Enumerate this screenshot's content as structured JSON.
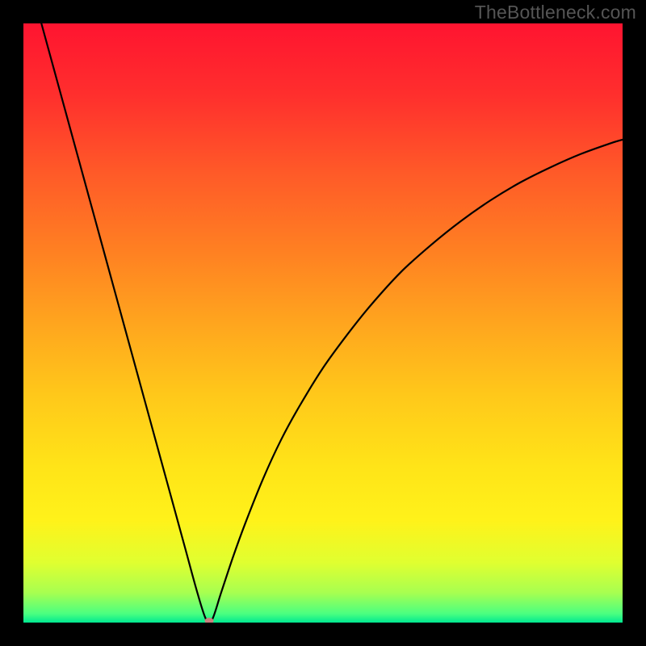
{
  "watermark": "TheBottleneck.com",
  "chart_data": {
    "type": "line",
    "title": "",
    "xlabel": "",
    "ylabel": "",
    "xlim": [
      0,
      100
    ],
    "ylim": [
      0,
      100
    ],
    "background_gradient_stops": [
      {
        "offset": 0.0,
        "color": "#ff1430"
      },
      {
        "offset": 0.12,
        "color": "#ff2f2d"
      },
      {
        "offset": 0.25,
        "color": "#ff5a28"
      },
      {
        "offset": 0.38,
        "color": "#ff8022"
      },
      {
        "offset": 0.5,
        "color": "#ffa51e"
      },
      {
        "offset": 0.62,
        "color": "#ffc81a"
      },
      {
        "offset": 0.74,
        "color": "#ffe418"
      },
      {
        "offset": 0.83,
        "color": "#fff21a"
      },
      {
        "offset": 0.9,
        "color": "#e0ff30"
      },
      {
        "offset": 0.95,
        "color": "#a8ff50"
      },
      {
        "offset": 0.985,
        "color": "#4bff80"
      },
      {
        "offset": 1.0,
        "color": "#00e890"
      }
    ],
    "series": [
      {
        "name": "bottleneck-curve",
        "color": "#000000",
        "x": [
          3,
          5,
          7,
          9,
          11,
          13,
          15,
          17,
          19,
          21,
          23,
          25,
          27,
          29,
          30.5,
          31.5,
          33,
          35,
          37,
          40,
          43,
          46,
          50,
          54,
          58,
          63,
          68,
          73,
          78,
          83,
          88,
          93,
          98,
          100
        ],
        "y": [
          100,
          92.7,
          85.4,
          78.1,
          70.8,
          63.5,
          56.2,
          48.9,
          41.6,
          34.3,
          27.0,
          19.7,
          12.4,
          5.1,
          0.5,
          0.5,
          5.0,
          11.0,
          16.5,
          24.0,
          30.5,
          36.0,
          42.5,
          48.0,
          53.0,
          58.5,
          63.0,
          67.0,
          70.5,
          73.5,
          76.0,
          78.2,
          80.0,
          80.6
        ]
      }
    ],
    "marker": {
      "x": 31.0,
      "y": 0.3,
      "color": "#c97f7d",
      "rx": 5.5,
      "ry": 3.8
    }
  }
}
